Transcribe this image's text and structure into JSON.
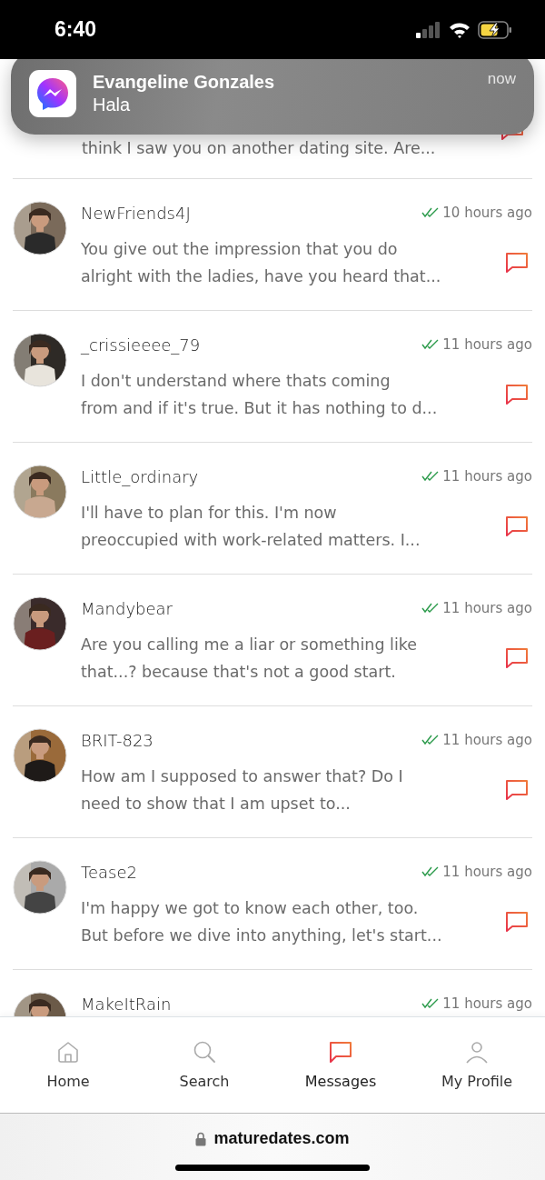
{
  "status_bar": {
    "time": "6:40"
  },
  "notification": {
    "title": "Evangeline Gonzales",
    "body": "Hala",
    "time": "now"
  },
  "conversations": [
    {
      "kind": "partial",
      "preview": [
        "think I saw you on another dating site. Are..."
      ]
    },
    {
      "kind": "full",
      "name": "NewFriends4J",
      "read": true,
      "time": "10 hours ago",
      "preview": [
        "You give out the impression that you do",
        "alright with the ladies, have you heard that..."
      ]
    },
    {
      "kind": "full",
      "name": "_crissieeee_79",
      "read": true,
      "time": "11 hours ago",
      "preview": [
        "I don't understand where thats coming",
        "from and if it's true. But it has nothing to d..."
      ]
    },
    {
      "kind": "full",
      "name": "Little_ordinary",
      "read": true,
      "time": "11 hours ago",
      "preview": [
        "I'll have to plan for this. I'm now",
        "preoccupied with work-related matters. I..."
      ]
    },
    {
      "kind": "full",
      "name": "Mandybear",
      "read": true,
      "time": "11 hours ago",
      "preview": [
        "Are you calling me a liar or something like",
        "that...? because that's not a good start."
      ]
    },
    {
      "kind": "full",
      "name": "BRIT-823",
      "read": true,
      "time": "11 hours ago",
      "preview": [
        "How am I supposed to answer that? Do I",
        "need to show that I am upset to..."
      ]
    },
    {
      "kind": "full",
      "name": "Tease2",
      "read": true,
      "time": "11 hours ago",
      "preview": [
        "I'm happy we got to know each other, too.",
        "But before we dive into anything, let's start..."
      ]
    },
    {
      "kind": "header",
      "name": "MakeItRain",
      "read": true,
      "time": "11 hours ago"
    }
  ],
  "nav": [
    {
      "kind": "home",
      "label": "Home",
      "selected": false
    },
    {
      "kind": "search",
      "label": "Search",
      "selected": false
    },
    {
      "kind": "messages",
      "label": "Messages",
      "selected": true
    },
    {
      "kind": "profile",
      "label": "My Profile",
      "selected": false
    }
  ],
  "browser": {
    "url": "maturedates.com"
  }
}
